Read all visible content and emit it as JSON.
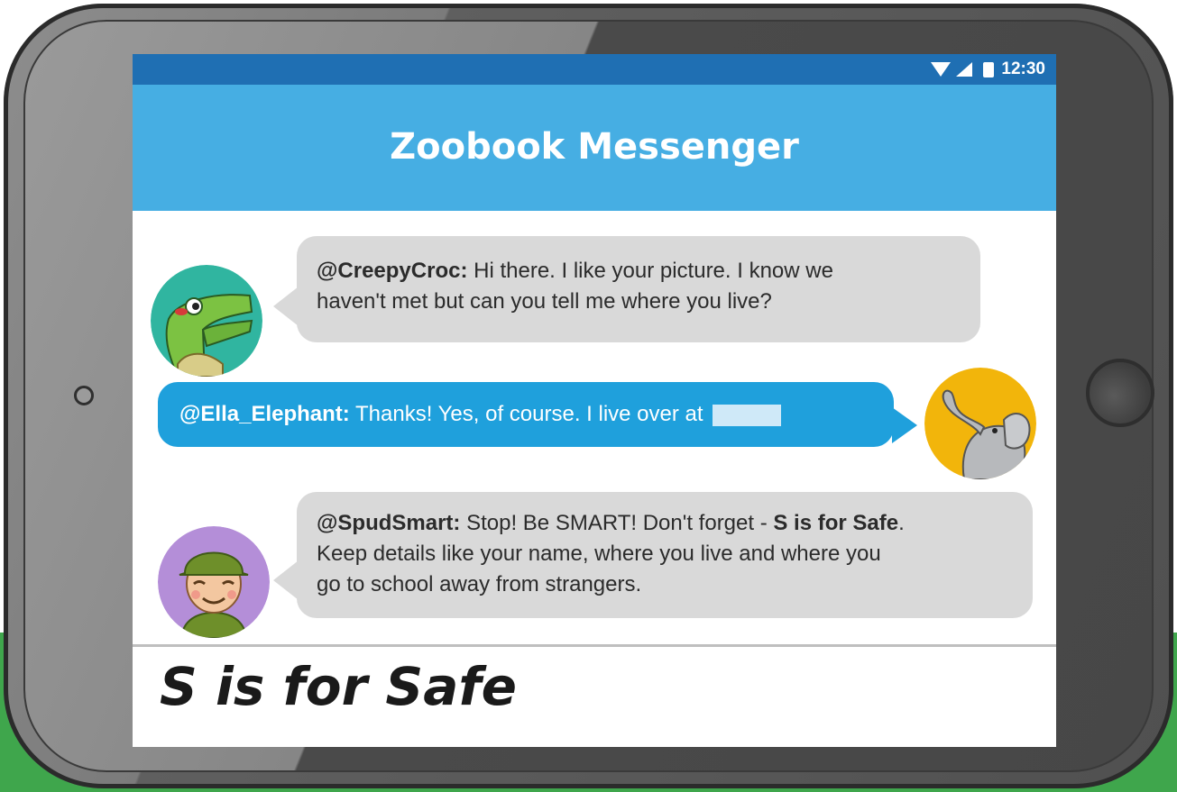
{
  "status_bar": {
    "time": "12:30",
    "icons": [
      "wifi-icon",
      "signal-icon",
      "battery-icon"
    ]
  },
  "app": {
    "title": "Zoobook Messenger"
  },
  "messages": [
    {
      "handle": "@CreepyCroc:",
      "text_lines": [
        "Hi there. I like your picture. I know we",
        "haven't met but can you tell me where you live?"
      ],
      "avatar": "crocodile-avatar",
      "side": "left"
    },
    {
      "handle": "@Ella_Elephant:",
      "text_lines": [
        "Thanks! Yes, of course. I live over at"
      ],
      "avatar": "elephant-avatar",
      "side": "right"
    },
    {
      "handle": "@SpudSmart:",
      "text_before": "Stop! Be SMART! Don't forget - ",
      "emphasis": "S is for Safe",
      "text_after": ".",
      "text_lines": [
        "Keep details like your name, where you live and where you",
        "go to school away from strangers."
      ],
      "avatar": "ranger-avatar",
      "side": "left"
    }
  ],
  "footer": {
    "title": "S is for Safe"
  },
  "colors": {
    "header": "#46aee3",
    "status_bar": "#1f6fb3",
    "incoming_bubble": "#d9d9d9",
    "outgoing_bubble": "#1fa0dc",
    "background_band": "#3fa64c"
  }
}
